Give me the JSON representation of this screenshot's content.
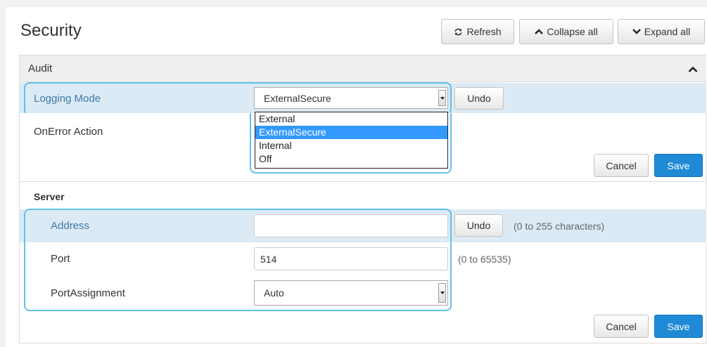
{
  "page": {
    "title": "Security"
  },
  "toolbar": {
    "refresh_label": "Refresh",
    "collapse_label": "Collapse all",
    "expand_label": "Expand all"
  },
  "audit": {
    "title": "Audit",
    "logging_mode": {
      "label": "Logging Mode",
      "selected": "ExternalSecure",
      "options": [
        "External",
        "ExternalSecure",
        "Internal",
        "Off"
      ],
      "undo_label": "Undo"
    },
    "onerror": {
      "label": "OnError Action"
    },
    "cancel_label": "Cancel",
    "save_label": "Save"
  },
  "server": {
    "title": "Server",
    "address": {
      "label": "Address",
      "value": "",
      "undo_label": "Undo",
      "hint": "(0 to 255 characters)"
    },
    "port": {
      "label": "Port",
      "value": "514",
      "hint": "(0 to 65535)"
    },
    "port_assignment": {
      "label": "PortAssignment",
      "selected": "Auto"
    },
    "cancel_label": "Cancel",
    "save_label": "Save"
  },
  "colors": {
    "accent": "#1f8ad6",
    "highlight_row": "#dbeaf4",
    "focus_ring": "#5fc1e8",
    "selected_option": "#3399ff"
  }
}
